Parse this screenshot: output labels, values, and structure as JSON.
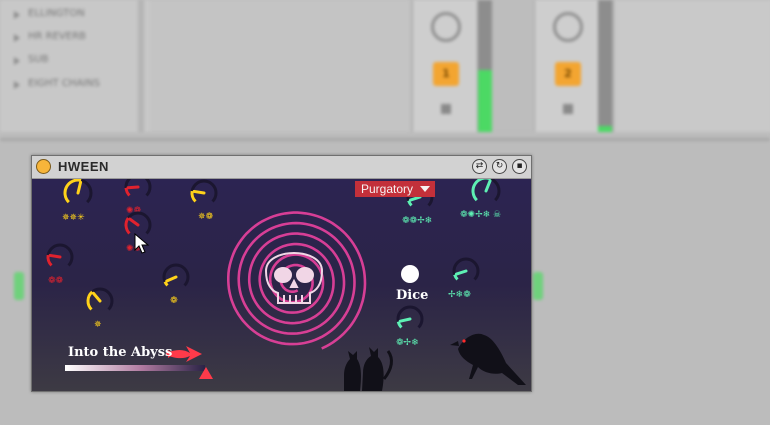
{
  "host": {
    "browser_items": [
      "ELLINGTON",
      "HR REVERB",
      "SUB",
      "EIGHT CHAINS"
    ],
    "track_buttons": [
      {
        "label": "1"
      },
      {
        "label": "2"
      }
    ],
    "meter_levels": [
      0.47,
      0.05
    ]
  },
  "device": {
    "title": "HWEEN",
    "title_bar_icons": [
      "loop-icon",
      "sync-icon",
      "save-icon"
    ],
    "preset": {
      "selected": "Purgatory"
    },
    "dice_label": "Dice",
    "abyss": {
      "label": "Into the Abyss",
      "value": 1.0
    },
    "colors": {
      "panel": "#2a2346",
      "spiral": "#e0409a",
      "yellow": "#ffd21a",
      "red": "#e0222e",
      "green": "#5ef0b4",
      "dropdown": "#c3303a"
    },
    "knobs": [
      {
        "id": "y1",
        "color": "yellow",
        "value": 0.55,
        "symbols": "✵✵✳"
      },
      {
        "id": "r1",
        "color": "red",
        "value": 0.15,
        "symbols": "✺❁"
      },
      {
        "id": "y2",
        "color": "yellow",
        "value": 0.2,
        "symbols": "✵❁"
      },
      {
        "id": "r2",
        "color": "red",
        "value": 0.3,
        "symbols": "✺❁"
      },
      {
        "id": "r3",
        "color": "red",
        "value": 0.2,
        "symbols": "❁❁"
      },
      {
        "id": "y3",
        "color": "yellow",
        "value": 0.08,
        "symbols": "❁"
      },
      {
        "id": "y4",
        "color": "yellow",
        "value": 0.35,
        "symbols": "✵"
      },
      {
        "id": "g1",
        "color": "green",
        "value": 0.1,
        "symbols": "❁❁✢❄"
      },
      {
        "id": "g2",
        "color": "green",
        "value": 0.58,
        "symbols": "❁✺✢❄ ☠"
      },
      {
        "id": "g3",
        "color": "green",
        "value": 0.1,
        "symbols": "✢❄❁"
      },
      {
        "id": "g4",
        "color": "green",
        "value": 0.12,
        "symbols": "❁✢❄"
      }
    ]
  }
}
